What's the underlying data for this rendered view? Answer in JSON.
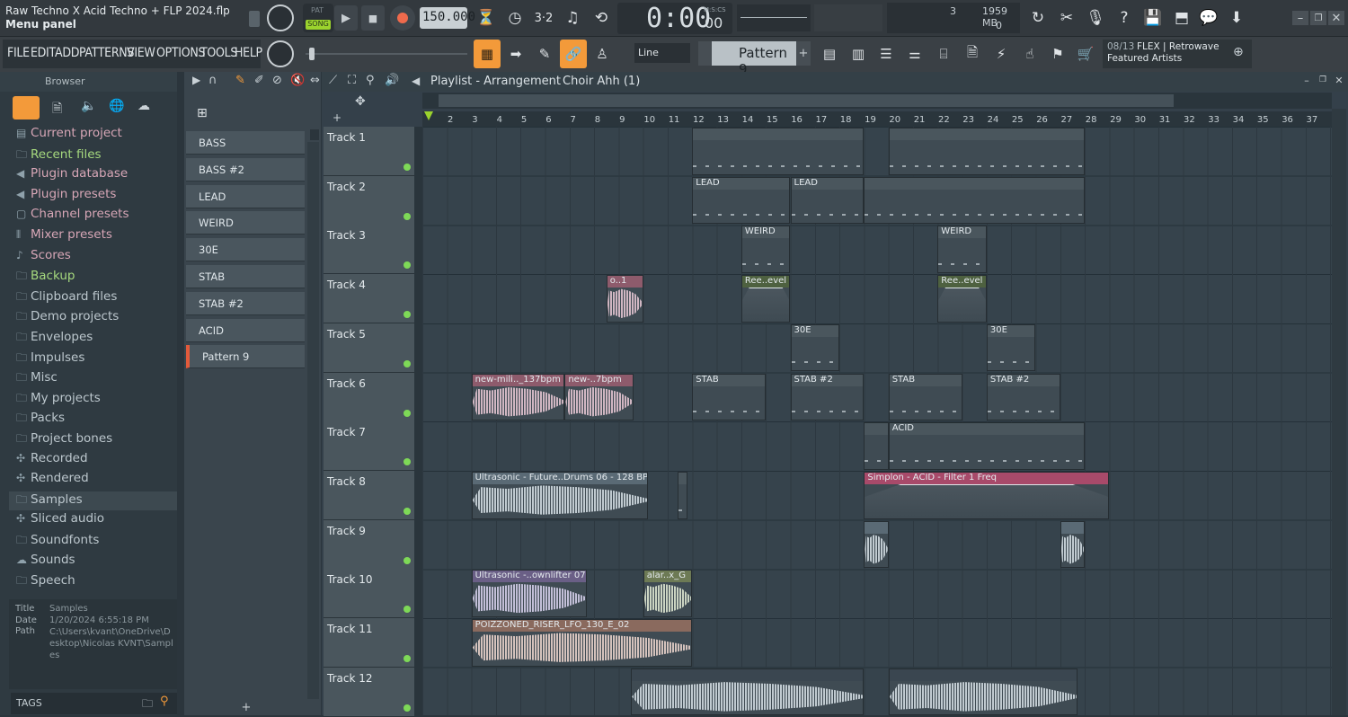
{
  "window": {
    "title": "Raw Techno X Acid Techno + FLP 2024.flp",
    "hint": "Menu panel"
  },
  "transport": {
    "pat_label": "PAT",
    "song_label": "SONG",
    "tempo": "150.000",
    "time": "0:00",
    "time_ms": "00",
    "time_unit": "M:S:CS",
    "cpu_num": "3",
    "memory": "1959 MB",
    "poly": "0"
  },
  "menu": [
    "FILE",
    "EDIT",
    "ADD",
    "PATTERNS",
    "VIEW",
    "OPTIONS",
    "TOOLS",
    "HELP"
  ],
  "snap": "Line",
  "pattern": "Pattern 9",
  "news": {
    "counter": "08/13",
    "line1": "FLEX | Retrowave",
    "line2": "Featured Artists"
  },
  "browser": {
    "title": "Browser",
    "items": [
      {
        "label": "Current project",
        "icon": "project-icon"
      },
      {
        "label": "Recent files",
        "icon": "folder-icon"
      },
      {
        "label": "Plugin database",
        "icon": "plugin-icon"
      },
      {
        "label": "Plugin presets",
        "icon": "plugin-icon"
      },
      {
        "label": "Channel presets",
        "icon": "channel-icon"
      },
      {
        "label": "Mixer presets",
        "icon": "mixer-icon"
      },
      {
        "label": "Scores",
        "icon": "note-icon"
      },
      {
        "label": "Backup",
        "icon": "folder-icon"
      },
      {
        "label": "Clipboard files",
        "icon": "folder-icon"
      },
      {
        "label": "Demo projects",
        "icon": "folder-icon"
      },
      {
        "label": "Envelopes",
        "icon": "folder-icon"
      },
      {
        "label": "Impulses",
        "icon": "folder-icon"
      },
      {
        "label": "Misc",
        "icon": "folder-icon"
      },
      {
        "label": "My projects",
        "icon": "folder-icon"
      },
      {
        "label": "Packs",
        "icon": "folder-icon"
      },
      {
        "label": "Project bones",
        "icon": "folder-icon"
      },
      {
        "label": "Recorded",
        "icon": "record-icon"
      },
      {
        "label": "Rendered",
        "icon": "record-icon"
      },
      {
        "label": "Samples",
        "icon": "folder-icon"
      },
      {
        "label": "Sliced audio",
        "icon": "record-icon"
      },
      {
        "label": "Soundfonts",
        "icon": "folder-icon"
      },
      {
        "label": "Sounds",
        "icon": "cloud-icon"
      },
      {
        "label": "Speech",
        "icon": "folder-icon"
      }
    ],
    "info": {
      "title_key": "Title",
      "title_val": "Samples",
      "date_key": "Date",
      "date_val": "1/20/2024 6:55:18 PM",
      "path_key": "Path",
      "path_val": "C:\\Users\\kvant\\OneDrive\\Desktop\\Nicolas KVNT\\Samples"
    },
    "tags": "TAGS"
  },
  "patterns": [
    "BASS",
    "BASS #2",
    "LEAD",
    "WEIRD",
    "30E",
    "STAB",
    "STAB #2",
    "ACID",
    "Pattern 9"
  ],
  "playlist": {
    "title": "Playlist - Arrangement",
    "crumb": "Choir Ahh (1)",
    "ruler": [
      "2",
      "3",
      "4",
      "5",
      "6",
      "7",
      "8",
      "9",
      "10",
      "11",
      "12",
      "13",
      "14",
      "15",
      "16",
      "17",
      "18",
      "19",
      "20",
      "21",
      "22",
      "23",
      "24",
      "25",
      "26",
      "27",
      "28",
      "29",
      "30",
      "31",
      "32",
      "33",
      "34",
      "35",
      "36",
      "37"
    ],
    "tracks": [
      "Track 1",
      "Track 2",
      "Track 3",
      "Track 4",
      "Track 5",
      "Track 6",
      "Track 7",
      "Track 8",
      "Track 9",
      "Track 10",
      "Track 11",
      "Track 12"
    ],
    "clips": [
      {
        "track": 2,
        "label": "LEAD"
      },
      {
        "track": 2,
        "label": "LEAD"
      },
      {
        "track": 3,
        "label": "WEIRD"
      },
      {
        "track": 3,
        "label": "WEIRD"
      },
      {
        "track": 4,
        "label": "o..1"
      },
      {
        "track": 4,
        "label": "Ree..evel"
      },
      {
        "track": 4,
        "label": "Ree..evel"
      },
      {
        "track": 5,
        "label": "30E"
      },
      {
        "track": 5,
        "label": "30E"
      },
      {
        "track": 6,
        "label": "new-mili.._137bpm"
      },
      {
        "track": 6,
        "label": "new-..7bpm"
      },
      {
        "track": 6,
        "label": "STAB"
      },
      {
        "track": 6,
        "label": "STAB #2"
      },
      {
        "track": 6,
        "label": "STAB"
      },
      {
        "track": 6,
        "label": "STAB #2"
      },
      {
        "track": 7,
        "label": "ACID"
      },
      {
        "track": 8,
        "label": "Ultrasonic - Future..Drums 06 - 128 BPM"
      },
      {
        "track": 8,
        "label": "Simplon - ACID - Filter 1 Freq"
      },
      {
        "track": 10,
        "label": "Ultrasonic -..ownlifter 07"
      },
      {
        "track": 10,
        "label": "alar..x_G"
      },
      {
        "track": 11,
        "label": "POIZZONED_RISER_LFO_130_E_02"
      }
    ]
  }
}
